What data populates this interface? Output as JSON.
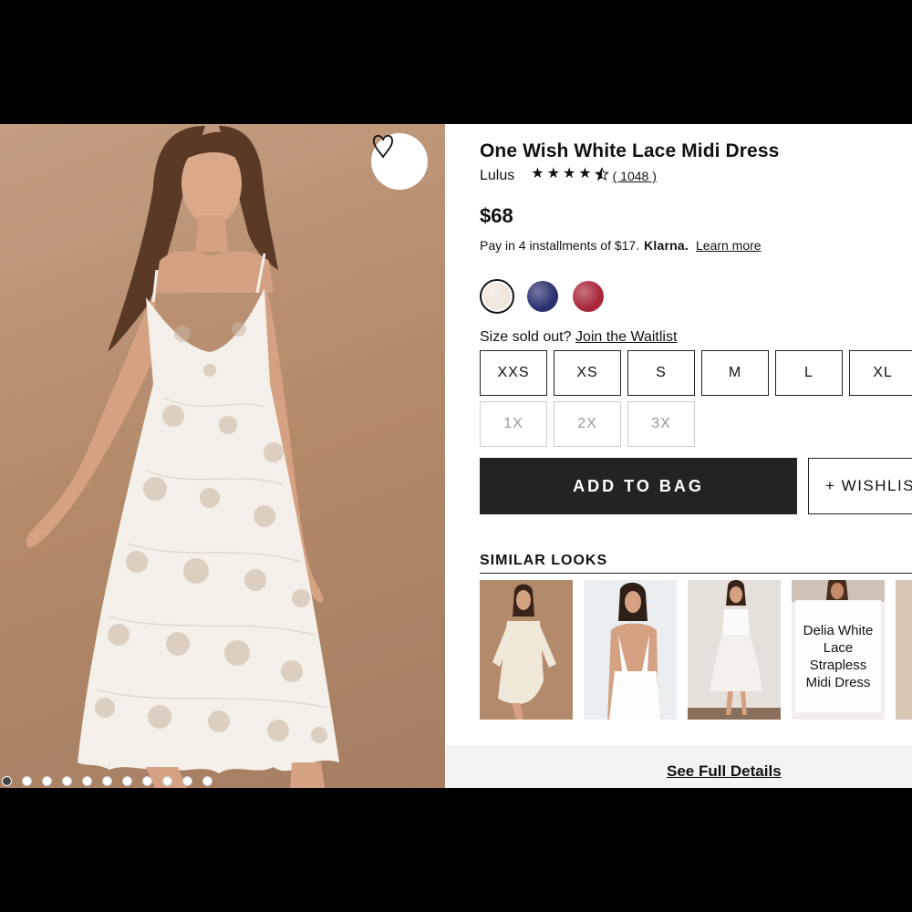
{
  "product": {
    "title": "One Wish White Lace Midi Dress",
    "brand": "Lulus",
    "rating": 4.5,
    "review_count": "( 1048 )",
    "price": "$68",
    "installments_text": "Pay in 4 installments of $17.",
    "klarna_logo": "Klarna.",
    "learn_more": "Learn more"
  },
  "gallery": {
    "active_index": 0,
    "dot_count": 11,
    "wishlist_icon": "heart-icon"
  },
  "colors": {
    "swatches": [
      {
        "name": "white-lace",
        "color": "#efe6dc",
        "selected": true
      },
      {
        "name": "navy-lace",
        "color": "#2b3170",
        "selected": false
      },
      {
        "name": "red-lace",
        "color": "#a8273a",
        "selected": false
      }
    ]
  },
  "sizes": {
    "sold_out_text": "Size sold out?",
    "waitlist_link": "Join the Waitlist",
    "options": [
      {
        "label": "XXS",
        "available": true
      },
      {
        "label": "XS",
        "available": true
      },
      {
        "label": "S",
        "available": true
      },
      {
        "label": "M",
        "available": true
      },
      {
        "label": "L",
        "available": true
      },
      {
        "label": "XL",
        "available": true
      },
      {
        "label": "1X",
        "available": false
      },
      {
        "label": "2X",
        "available": false
      },
      {
        "label": "3X",
        "available": false
      }
    ]
  },
  "actions": {
    "add_to_bag": "ADD TO BAG",
    "wishlist": "+ WISHLIS"
  },
  "similar": {
    "title": "SIMILAR LOOKS",
    "items": [
      {
        "label": ""
      },
      {
        "label": ""
      },
      {
        "label": ""
      },
      {
        "label": "Delia White Lace Strapless Midi Dress"
      }
    ]
  },
  "footer": {
    "see_details": "See Full Details"
  },
  "theme": {
    "image_bg": "#b48d71",
    "button_dark": "#232323",
    "details_bg": "#f3f3f3"
  }
}
